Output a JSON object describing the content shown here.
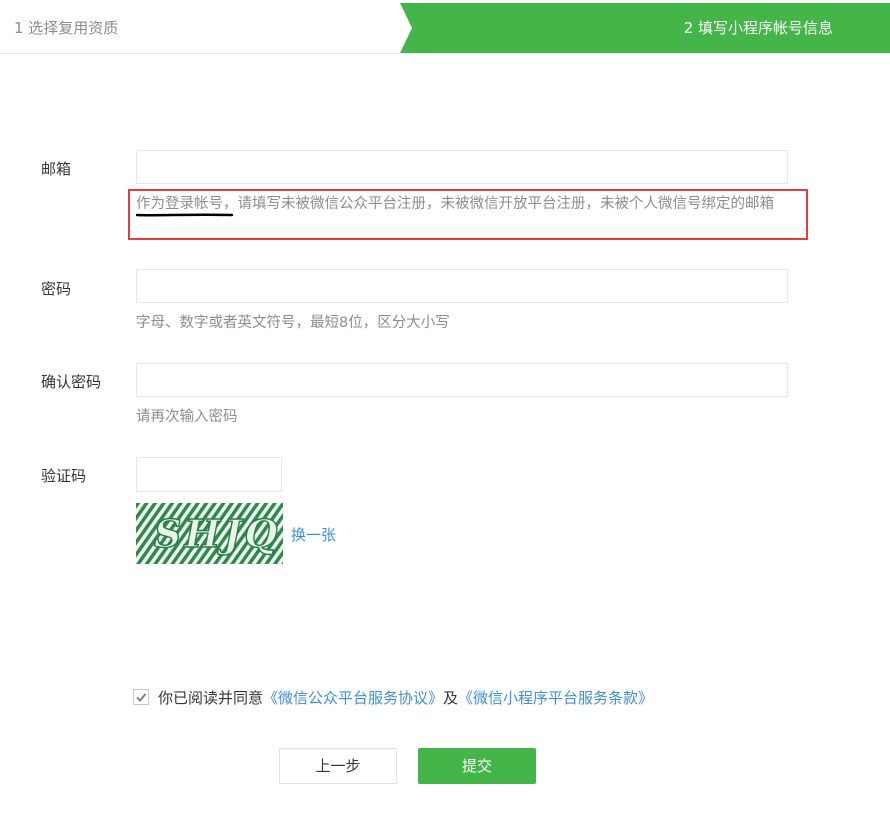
{
  "steps": {
    "step1": "1 选择复用资质",
    "step2": "2 填写小程序帐号信息",
    "active_color": "#44b549"
  },
  "email": {
    "label": "邮箱",
    "value": "",
    "hint_highlight": "作为登录帐号",
    "hint_rest": "，请填写未被微信公众平台注册，未被微信开放平台注册，未被个人微信号绑定的邮箱"
  },
  "password": {
    "label": "密码",
    "value": "",
    "hint": "字母、数字或者英文符号，最短8位，区分大小写"
  },
  "confirm": {
    "label": "确认密码",
    "value": "",
    "hint": "请再次输入密码"
  },
  "captcha": {
    "label": "验证码",
    "value": "",
    "image_text": "SHJQ",
    "refresh_label": "换一张"
  },
  "agreement": {
    "checked": true,
    "prefix": "你已阅读并同意",
    "link1": "《微信公众平台服务协议》",
    "and": "及",
    "link2": "《微信小程序平台服务条款》"
  },
  "buttons": {
    "prev": "上一步",
    "submit": "提交"
  },
  "colors": {
    "accent": "#44b549",
    "link": "#3e8fd8",
    "annotation": "#e43c3c"
  }
}
